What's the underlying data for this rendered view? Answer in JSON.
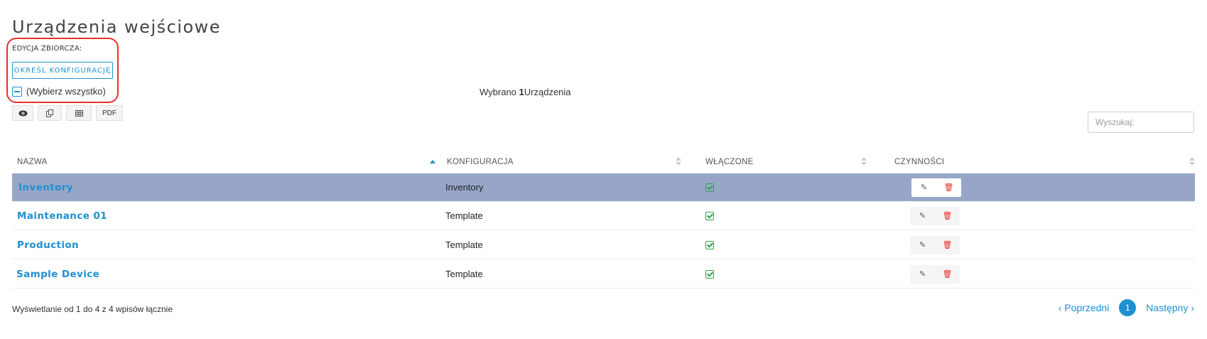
{
  "page": {
    "title": "Urządzenia wejściowe"
  },
  "bulk_edit": {
    "label": "EDYCJA ZBIORCZA:",
    "config_button": "OKREŚL KONFIGURACJĘ",
    "select_all": "(Wybierz wszystko)"
  },
  "selection": {
    "prefix": "Wybrano ",
    "count": "1",
    "suffix": "Urządzenia"
  },
  "toolbar": [
    {
      "icon": "eye-icon",
      "glyph": "👁"
    },
    {
      "icon": "copy-icon",
      "glyph": "⧉"
    },
    {
      "icon": "table-icon",
      "glyph": "▦"
    },
    {
      "icon": "pdf-icon",
      "glyph": "PDF"
    }
  ],
  "search": {
    "placeholder": "Wyszukaj:"
  },
  "table": {
    "columns": [
      "NAZWA",
      "KONFIGURACJA",
      "WŁĄCZONE",
      "CZYNNOŚCI"
    ],
    "rows": [
      {
        "name": "Inventory",
        "config": "Inventory",
        "enabled": true,
        "selected": true
      },
      {
        "name": "Maintenance 01",
        "config": "Template",
        "enabled": true,
        "selected": false
      },
      {
        "name": "Production",
        "config": "Template",
        "enabled": true,
        "selected": false
      },
      {
        "name": "Sample Device",
        "config": "Template",
        "enabled": true,
        "selected": false
      }
    ]
  },
  "footer": {
    "info": "Wyświetlanie od 1 do 4 z 4 wpisów łącznie",
    "prev": "‹ Poprzedni",
    "page": "1",
    "next": "Następny ›"
  },
  "colors": {
    "accent": "#1f8fd0",
    "selected_row": "#97a6c8",
    "highlight": "#e53228",
    "enabled": "#2ea44f"
  }
}
